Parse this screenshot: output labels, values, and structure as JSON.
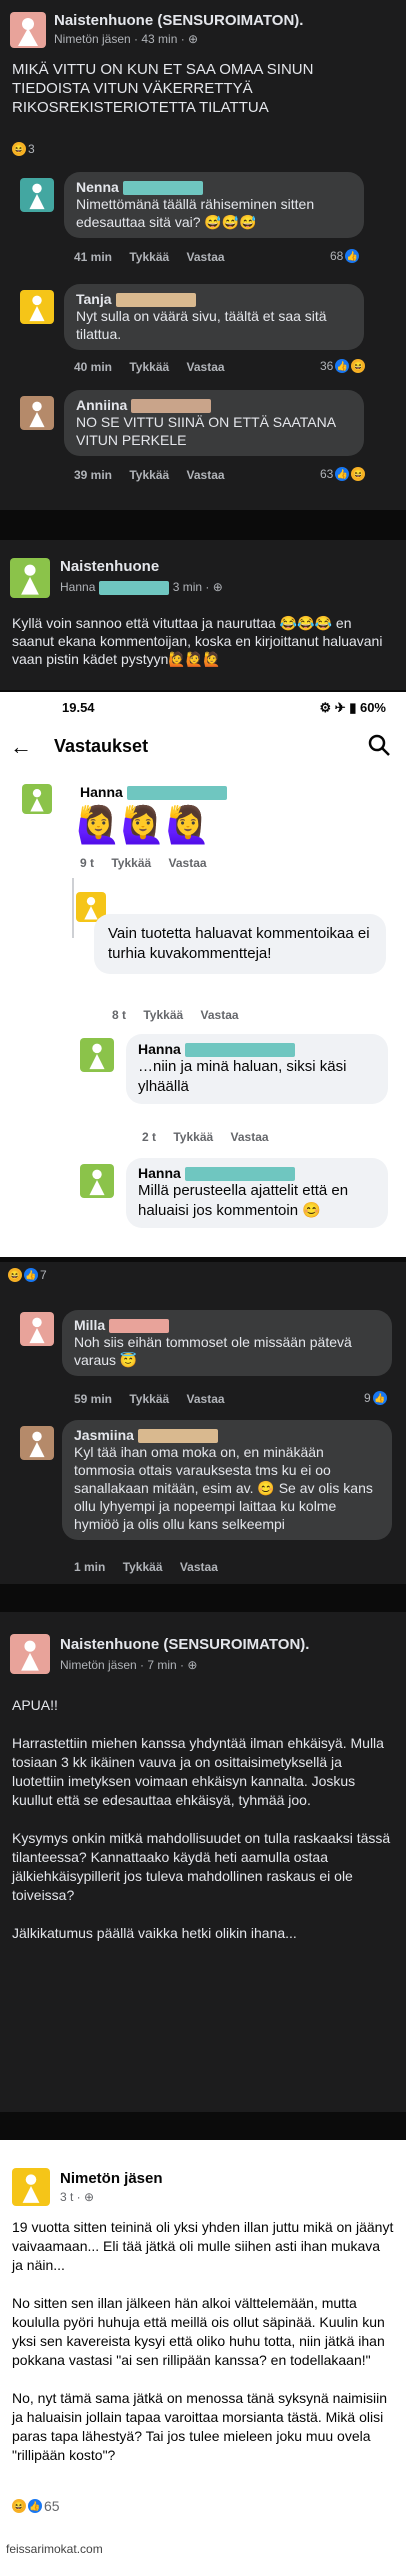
{
  "colors": {
    "green": "#8bc34a",
    "yellow": "#f5c518",
    "brown": "#b58a6a",
    "pink": "#e8a39a",
    "teal": "#43a7a1",
    "blur": "#6fc6c0"
  },
  "post1": {
    "group": "Naistenhuone (SENSUROIMATON).",
    "meta": "Nimetön jäsen · 43 min · ⊕",
    "text": "MIKÄ VITTU ON KUN ET SAA OMAA SINUN TIEDOISTA VITUN VÄKERRETTYÄ RIKOSREKISTERIOTETTA TILATTUA",
    "reactions": "3",
    "comments": [
      {
        "name": "Nenna",
        "text": "Nimettömänä täällä rähiseminen sitten edesauttaa sitä vai? 😅😅😅",
        "time": "41 min",
        "like": "Tykkää",
        "reply": "Vastaa",
        "count": "68"
      },
      {
        "name": "Tanja",
        "text": "Nyt sulla on väärä sivu, täältä et saa sitä tilattua.",
        "time": "40 min",
        "like": "Tykkää",
        "reply": "Vastaa",
        "count": "36"
      },
      {
        "name": "Anniina",
        "text": "NO SE VITTU SIINÄ ON ETTÄ SAATANA VITUN PERKELE",
        "time": "39 min",
        "like": "Tykkää",
        "reply": "Vastaa",
        "count": "63"
      }
    ]
  },
  "post2": {
    "group": "Naistenhuone",
    "author": "Hanna",
    "time": "3 min · ⊕",
    "text": "Kyllä voin sannoo että vituttaa ja nauruttaa 😂😂😂 en saanut ekana kommentoijan, koska en kirjoittanut haluavani vaan pistin kädet pystyyn🙋🙋🙋"
  },
  "phone": {
    "clock": "19.54",
    "status_right": "⚙ ✈ ▮ 60%",
    "header": "Vastaukset",
    "hanna_top": {
      "name": "Hanna",
      "emoji": "🙋‍♀️🙋‍♀️🙋‍♀️",
      "time": "9 t",
      "like": "Tykkää",
      "reply": "Vastaa"
    },
    "reply1": {
      "text": "Vain tuotetta haluavat kommentoikaa ei turhia kuvakommentteja!",
      "time": "8 t",
      "like": "Tykkää",
      "reply": "Vastaa"
    },
    "reply2": {
      "name": "Hanna",
      "text": "…niin ja minä haluan, siksi käsi ylhäällä",
      "time": "2 t",
      "like": "Tykkää",
      "reply": "Vastaa"
    },
    "reply3": {
      "name": "Hanna",
      "text": "Millä perusteella ajattelit että en haluaisi jos kommentoin 😊"
    }
  },
  "post3": {
    "reactions": "7",
    "comments": [
      {
        "name": "Milla",
        "text": "Noh siis eihän tommoset ole missään pätevä varaus 😇",
        "time": "59 min",
        "like": "Tykkää",
        "reply": "Vastaa",
        "count": "9"
      },
      {
        "name": "Jasmiina",
        "text": "Kyl tää ihan oma moka on, en minäkään tommosia ottais varauksesta tms ku ei oo sanallakaan mitään, esim av. 😊 Se av olis kans ollu lyhyempi ja nopeempi laittaa ku kolme hymiöö ja olis ollu kans selkeempi",
        "time": "1 min",
        "like": "Tykkää",
        "reply": "Vastaa"
      }
    ]
  },
  "post4": {
    "group": "Naistenhuone (SENSUROIMATON).",
    "meta": "Nimetön jäsen · 7 min · ⊕",
    "text": "APUA!!\n\nHarrastettiin miehen kanssa yhdyntää ilman ehkäisyä. Mulla tosiaan 3 kk ikäinen vauva ja on osittaisimetyksellä ja luotettiin imetyksen voimaan ehkäisyn kannalta. Joskus kuullut että se edesauttaa ehkäisyä, tyhmää joo.\n\nKysymys onkin mitkä mahdollisuudet on tulla raskaaksi tässä tilanteessa? Kannattaako käydä heti aamulla ostaa jälkiehkäisypillerit jos tuleva mahdollinen raskaus ei ole toiveissa?\n\nJälkikatumus päällä vaikka hetki olikin ihana..."
  },
  "post5": {
    "author": "Nimetön jäsen",
    "time": "3 t · ⊕",
    "text": "19 vuotta sitten teininä oli yksi yhden illan juttu mikä on jäänyt vaivaamaan... Eli tää jätkä oli mulle siihen asti ihan mukava ja näin...\n\nNo sitten sen illan jälkeen hän alkoi välttelemään, mutta koululla pyöri huhuja että meillä ois ollut säpinää. Kuulin kun yksi sen kavereista kysyi että oliko huhu totta, niin jätkä ihan pokkana vastasi \"ai sen rillipään kanssa? en todellakaan!\"\n\nNo, nyt tämä sama jätkä on menossa tänä syksynä naimisiin ja haluaisin jollain tapaa varoittaa morsianta tästä. Mikä olisi paras tapa lähestyä? Tai jos tulee mieleen joku muu ovela \"rillipään kosto\"?",
    "reactions": "65"
  },
  "footer": "feissarimokat.com"
}
